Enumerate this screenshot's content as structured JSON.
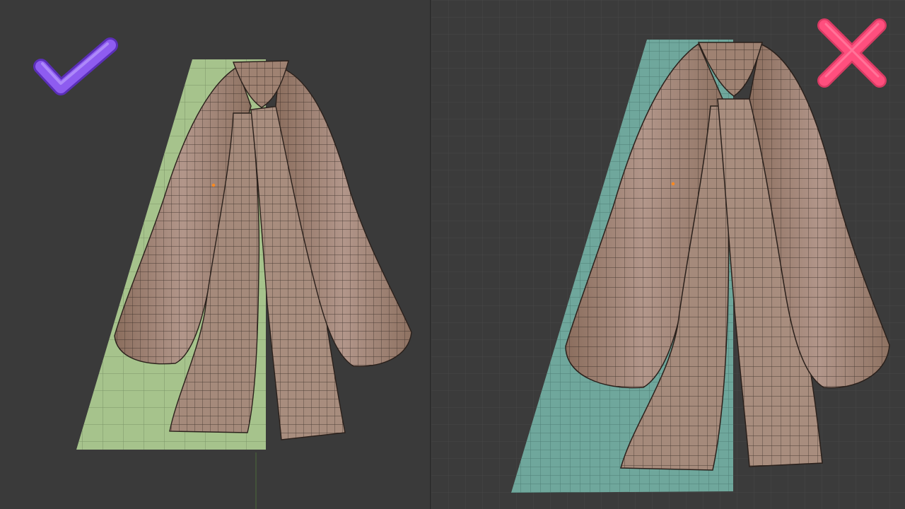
{
  "comparison": {
    "left_panel": {
      "verdict": "correct",
      "verdict_icon": "checkmark-icon",
      "verdict_color": "#8e5cf0",
      "ground_plane_color": "#a6c38c",
      "mesh_color": "#a18472",
      "grid": false
    },
    "right_panel": {
      "verdict": "incorrect",
      "verdict_icon": "cross-icon",
      "verdict_color": "#ff4f7e",
      "ground_plane_color": "#6fa79c",
      "mesh_color": "#a18472",
      "grid": true
    }
  }
}
